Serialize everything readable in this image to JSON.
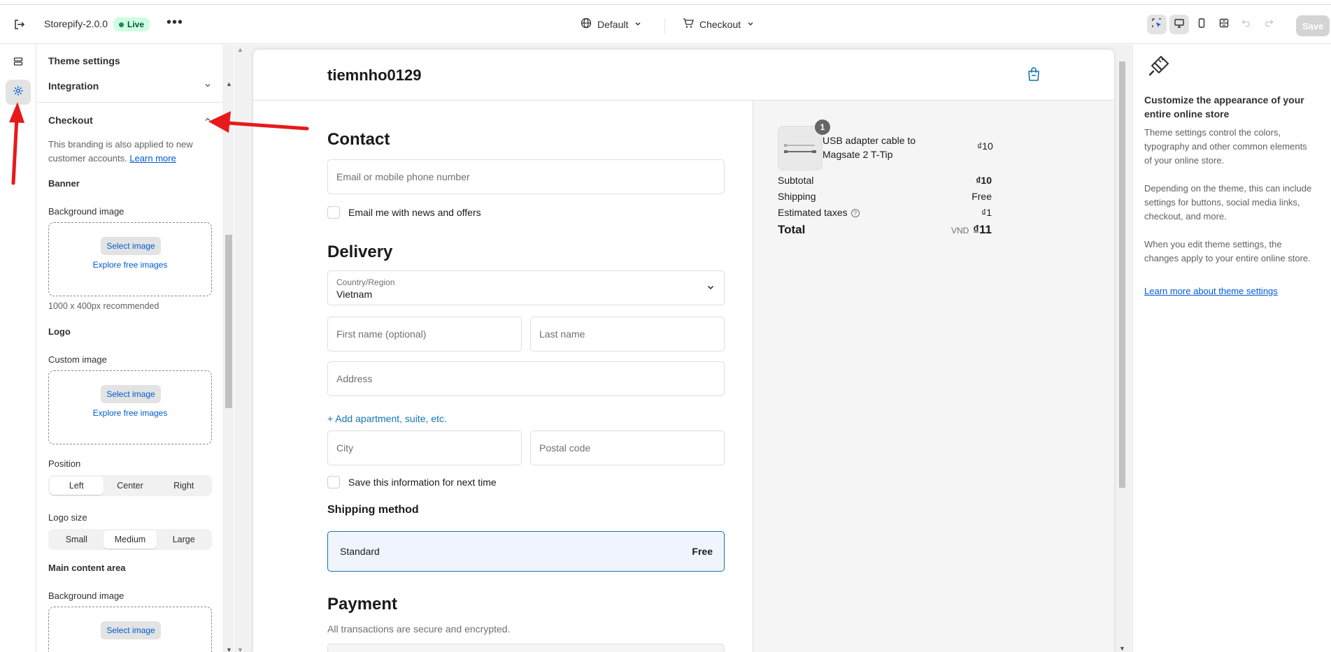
{
  "topbar": {
    "store_name": "Storepify-2.0.0",
    "live_badge": "Live",
    "more": "•••",
    "theme_selector": "Default",
    "template_selector": "Checkout",
    "save_label": "Save"
  },
  "sidebar": {
    "title": "Theme settings",
    "integration": "Integration",
    "checkout": "Checkout",
    "checkout_desc": "This branding is also applied to new customer accounts.",
    "learn_more": "Learn more",
    "banner": "Banner",
    "background_image": "Background image",
    "select_image": "Select image",
    "explore_free": "Explore free images",
    "recommended": "1000 x 400px recommended",
    "logo": "Logo",
    "custom_image": "Custom image",
    "position_label": "Position",
    "position_options": [
      "Left",
      "Center",
      "Right"
    ],
    "position_selected": "Left",
    "logo_size_label": "Logo size",
    "logo_size_options": [
      "Small",
      "Medium",
      "Large"
    ],
    "logo_size_selected": "Medium",
    "main_content": "Main content area",
    "main_bg_image": "Background image"
  },
  "preview": {
    "store_title": "tiemnho0129",
    "contact_heading": "Contact",
    "email_placeholder": "Email or mobile phone number",
    "email_news": "Email me with news and offers",
    "delivery_heading": "Delivery",
    "country_label": "Country/Region",
    "country_value": "Vietnam",
    "first_name": "First name (optional)",
    "last_name": "Last name",
    "address": "Address",
    "add_apartment": "+ Add apartment, suite, etc.",
    "city": "City",
    "postal_code": "Postal code",
    "save_info": "Save this information for next time",
    "shipping_method_heading": "Shipping method",
    "shipping_option": "Standard",
    "shipping_option_price": "Free",
    "payment_heading": "Payment",
    "payment_sub": "All transactions are secure and encrypted."
  },
  "summary": {
    "product_qty": "1",
    "product_name": "USB adapter cable to Magsate 2 T-Tip",
    "product_price": "₫10",
    "subtotal_label": "Subtotal",
    "subtotal_value": "₫10",
    "shipping_label": "Shipping",
    "shipping_value": "Free",
    "taxes_label": "Estimated taxes",
    "taxes_value": "₫1",
    "total_label": "Total",
    "total_currency": "VND",
    "total_value": "₫11"
  },
  "right_panel": {
    "title": "Customize the appearance of your entire online store",
    "p1": "Theme settings control the colors, typography and other common elements of your online store.",
    "p2": "Depending on the theme, this can include settings for buttons, social media links, checkout, and more.",
    "p3": "When you edit theme settings, the changes apply to your entire online store.",
    "link": "Learn more about theme settings"
  },
  "colors": {
    "accent": "#005bd3",
    "checkout_link": "#1773b0",
    "annotation_arrow": "#e8191a",
    "live_badge_bg": "#cdfee1"
  }
}
